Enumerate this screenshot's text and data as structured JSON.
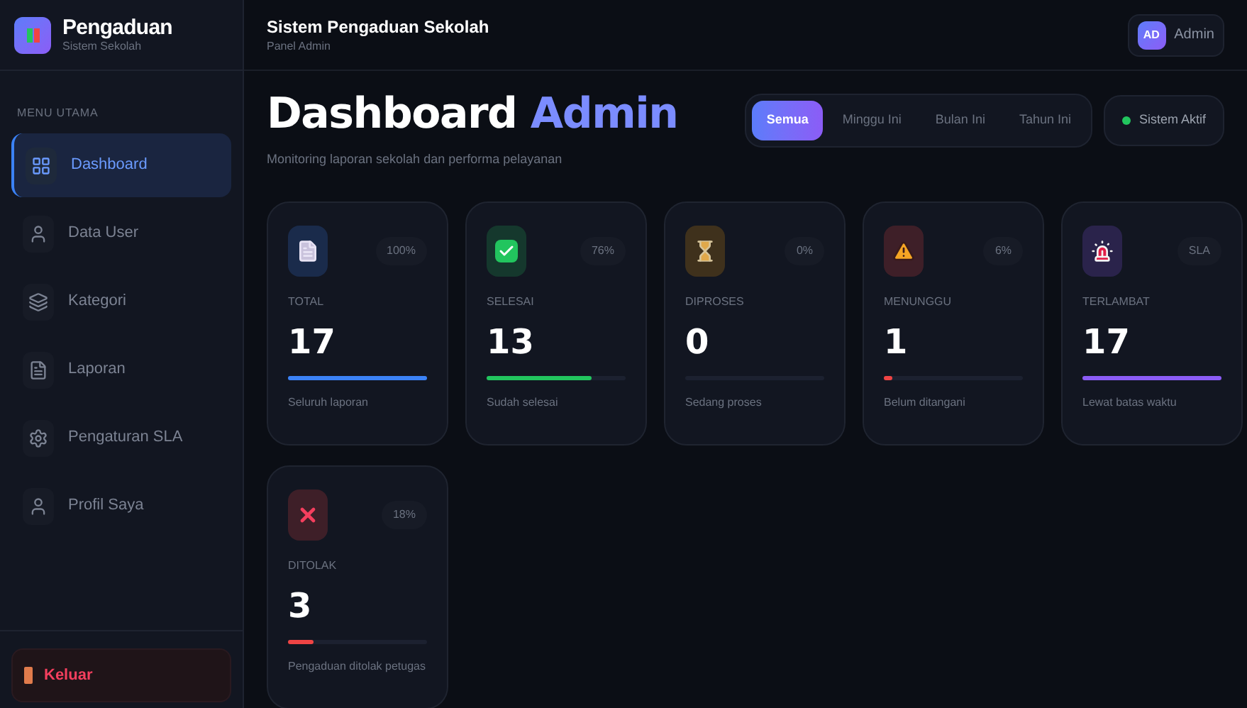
{
  "brand": {
    "name": "Pengaduan",
    "subtitle": "Sistem Sekolah"
  },
  "header": {
    "title": "Sistem Pengaduan Sekolah",
    "subtitle": "Panel Admin",
    "user": {
      "initials": "AD",
      "name": "Admin"
    }
  },
  "sidebar": {
    "section": "MENU UTAMA",
    "items": [
      {
        "label": "Dashboard",
        "selected": true
      },
      {
        "label": "Data User",
        "selected": false
      },
      {
        "label": "Kategori",
        "selected": false
      },
      {
        "label": "Laporan",
        "selected": false
      },
      {
        "label": "Pengaturan SLA",
        "selected": false
      },
      {
        "label": "Profil Saya",
        "selected": false
      }
    ],
    "logout": "Keluar"
  },
  "page": {
    "title": "Dashboard",
    "title_accent": "Admin",
    "subtitle": "Monitoring laporan sekolah dan performa pelayanan"
  },
  "filters": [
    {
      "label": "Semua",
      "selected": true
    },
    {
      "label": "Minggu Ini",
      "selected": false
    },
    {
      "label": "Bulan Ini",
      "selected": false
    },
    {
      "label": "Tahun Ini",
      "selected": false
    }
  ],
  "system_status": {
    "label": "Sistem Aktif",
    "on": true
  },
  "cards": [
    {
      "kind": "document",
      "label": "TOTAL",
      "value": "17",
      "badge": "100%",
      "level": 1,
      "caption": "Seluruh laporan"
    },
    {
      "kind": "check",
      "label": "SELESAI",
      "value": "13",
      "badge": "76%",
      "level": 0.76,
      "caption": "Sudah selesai"
    },
    {
      "kind": "hourglass",
      "label": "DIPROSES",
      "value": "0",
      "badge": "0%",
      "level": 0,
      "caption": "Sedang proses"
    },
    {
      "kind": "warning",
      "label": "MENUNGGU",
      "value": "1",
      "badge": "6%",
      "level": 0.06,
      "caption": "Belum ditangani"
    },
    {
      "kind": "siren",
      "label": "TERLAMBAT",
      "value": "17",
      "badge": "SLA",
      "level": 1,
      "caption": "Lewat batas waktu"
    },
    {
      "kind": "cross",
      "label": "DITOLAK",
      "value": "3",
      "badge": "18%",
      "level": 0.18,
      "caption": "Pengaduan ditolak petugas"
    }
  ]
}
